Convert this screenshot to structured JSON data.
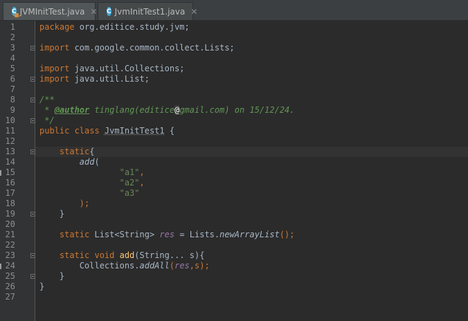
{
  "tabs": [
    {
      "label": "JVMInitTest.java",
      "icon": "class-icon",
      "icon_letter": "C",
      "active": true
    },
    {
      "label": "JvmInitTest1.java",
      "icon": "class-icon",
      "icon_letter": "C",
      "active": false
    }
  ],
  "close_glyph": "✕",
  "line_numbers": [
    "1",
    "2",
    "3",
    "4",
    "5",
    "6",
    "7",
    "8",
    "9",
    "10",
    "11",
    "12",
    "13",
    "14",
    "15",
    "16",
    "17",
    "18",
    "19",
    "20",
    "21",
    "22",
    "23",
    "24",
    "25",
    "26",
    "27"
  ],
  "code": {
    "l1_kw": "package",
    "l1_rest": " org.editice.study.jvm;",
    "l3_kw": "import",
    "l3_rest": " com.google.common.collect.Lists;",
    "l5_kw": "import",
    "l5_rest": " java.util.Collections;",
    "l6_kw": "import",
    "l6_rest": " java.util.List;",
    "l8": "/**",
    "l9_star": " * ",
    "l9_tag": "@author",
    "l9_a": " tinglang(editice",
    "l9_at": "@",
    "l9_b": "gmail.com) on 15/12/24.",
    "l10": " */",
    "l11_kw": "public class ",
    "l11_name": "JvmInitTest1",
    "l11_rest": " {",
    "l13_kw": "static",
    "l13_rest": "{",
    "l14_fn": "add",
    "l14_rest": "(",
    "l15": "\"a1\"",
    "l15_comma": ",",
    "l16": "\"a2\"",
    "l16_comma": ",",
    "l17": "\"a3\"",
    "l18": ");",
    "l19": "}",
    "l21_kw": "static ",
    "l21_type": "List<String> ",
    "l21_field": "res",
    "l21_eq": " = Lists.",
    "l21_fn": "newArrayList",
    "l21_end": "();",
    "l23_kw": "static void ",
    "l23_fn": "add",
    "l23_rest": "(String... s){",
    "l24_a": "Collections.",
    "l24_fn": "addAll",
    "l24_p": "(",
    "l24_field": "res",
    "l24_rest": ",s);",
    "l25": "}",
    "l26": "}"
  },
  "colors": {
    "keyword": "#cc7832",
    "string": "#6a8759",
    "doc_comment": "#629755",
    "field": "#9876aa",
    "method": "#ffc66d",
    "text": "#a9b7c6",
    "background": "#2b2b2b"
  }
}
